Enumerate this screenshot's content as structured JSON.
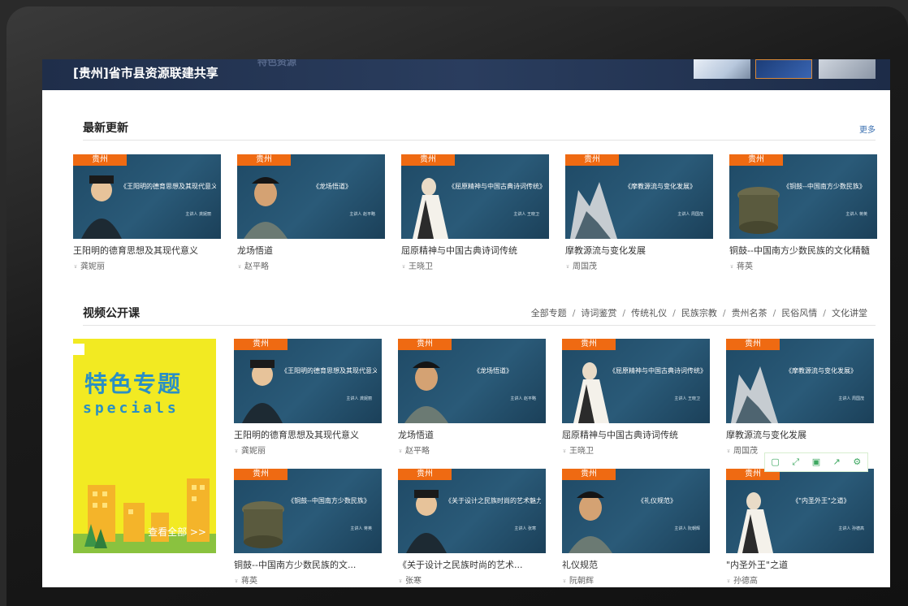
{
  "banner": {
    "title": "[贵州]省市县资源联建共享",
    "ghost_text": "特色资源"
  },
  "latest": {
    "title": "最新更新",
    "more_label": "更多"
  },
  "video": {
    "title": "视频公开课",
    "categories": [
      "全部专题",
      "诗词鉴赏",
      "传统礼仪",
      "民族宗教",
      "贵州名茶",
      "民俗风情",
      "文化讲堂"
    ]
  },
  "tag_label": "贵州",
  "latest_cards": [
    {
      "subtitle": "《王阳明的德育思想及其现代意义》",
      "speaker": "主讲人  龚妮丽",
      "name": "王阳明的德育思想及其现代意义",
      "author": "龚妮丽"
    },
    {
      "subtitle": "《龙场悟道》",
      "speaker": "主讲人  赵平略",
      "name": "龙场悟道",
      "author": "赵平略"
    },
    {
      "subtitle": "《屈原精神与中国古典诗词传统》",
      "speaker": "主讲人  王晓卫",
      "name": "屈原精神与中国古典诗词传统",
      "author": "王晓卫"
    },
    {
      "subtitle": "《摩教源流与变化发展》",
      "speaker": "主讲人  周国茂",
      "name": "摩教源流与变化发展",
      "author": "周国茂"
    },
    {
      "subtitle": "《铜鼓--中国南方少数民族》",
      "speaker": "主讲人  蒋英",
      "name": "铜鼓--中国南方少数民族的文化精髓",
      "author": "蒋英"
    }
  ],
  "video_cards_row1": [
    {
      "subtitle": "《王阳明的德育思想及其现代意义》",
      "speaker": "主讲人  龚妮丽",
      "name": "王阳明的德育思想及其现代意义",
      "author": "龚妮丽"
    },
    {
      "subtitle": "《龙场悟道》",
      "speaker": "主讲人  赵平略",
      "name": "龙场悟道",
      "author": "赵平略"
    },
    {
      "subtitle": "《屈原精神与中国古典诗词传统》",
      "speaker": "主讲人  王晓卫",
      "name": "屈原精神与中国古典诗词传统",
      "author": "王晓卫"
    },
    {
      "subtitle": "《摩教源流与变化发展》",
      "speaker": "主讲人  周国茂",
      "name": "摩教源流与变化发展",
      "author": "周国茂"
    }
  ],
  "video_cards_row2": [
    {
      "subtitle": "《铜鼓--中国南方少数民族》",
      "speaker": "主讲人  蒋英",
      "name": "铜鼓--中国南方少数民族的文...",
      "author": "蒋英"
    },
    {
      "subtitle": "《关于设计之民族时尚的艺术魅力》",
      "speaker": "主讲人  张寒",
      "name": "《关于设计之民族时尚的艺术...",
      "author": "张寒"
    },
    {
      "subtitle": "《礼仪规范》",
      "speaker": "主讲人  阮朝辉",
      "name": "礼仪规范",
      "author": "阮朝辉"
    },
    {
      "subtitle": "《\"内圣外王\"之道》",
      "speaker": "主讲人  孙德高",
      "name": "\"内圣外王\"之道",
      "author": "孙德高"
    }
  ],
  "promo": {
    "title": "特色专题",
    "subtitle": "specials",
    "view_all": "查看全部 >>"
  },
  "float_bar_icons": [
    "frame-icon",
    "expand-icon",
    "save-icon",
    "share-icon",
    "settings-icon"
  ]
}
